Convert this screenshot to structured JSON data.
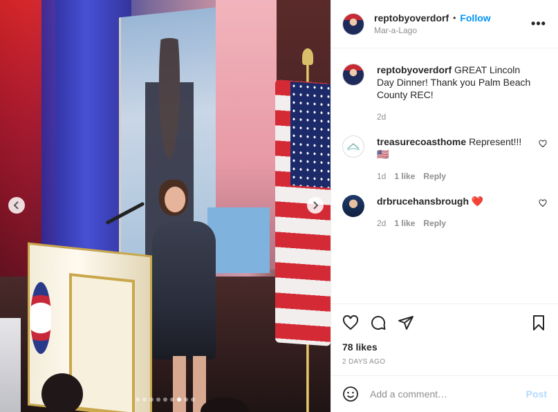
{
  "post": {
    "username": "reptobyoverdorf",
    "separator": "•",
    "follow_label": "Follow",
    "location": "Mar-a-Lago",
    "more_label": "•••"
  },
  "media": {
    "nav_prev": "previous-slide",
    "nav_next": "next-slide",
    "slide_count": 9,
    "active_slide": 7
  },
  "caption": {
    "username": "reptobyoverdorf",
    "text": "GREAT Lincoln Day Dinner! Thank you Palm Beach County REC!",
    "time": "2d"
  },
  "comments": [
    {
      "username": "treasurecoasthome",
      "text": "Represent!!! 🇺🇸",
      "time": "1d",
      "likes": "1 like",
      "reply": "Reply"
    },
    {
      "username": "drbrucehansbrough",
      "text": "❤️",
      "time": "2d",
      "likes": "1 like",
      "reply": "Reply"
    }
  ],
  "actions": {
    "likes": "78 likes",
    "date": "2 DAYS AGO"
  },
  "add_comment": {
    "placeholder": "Add a comment…",
    "post_label": "Post"
  },
  "colors": {
    "accent": "#0095f6",
    "post_disabled": "#b3dbff",
    "muted": "#8e8e8e"
  }
}
